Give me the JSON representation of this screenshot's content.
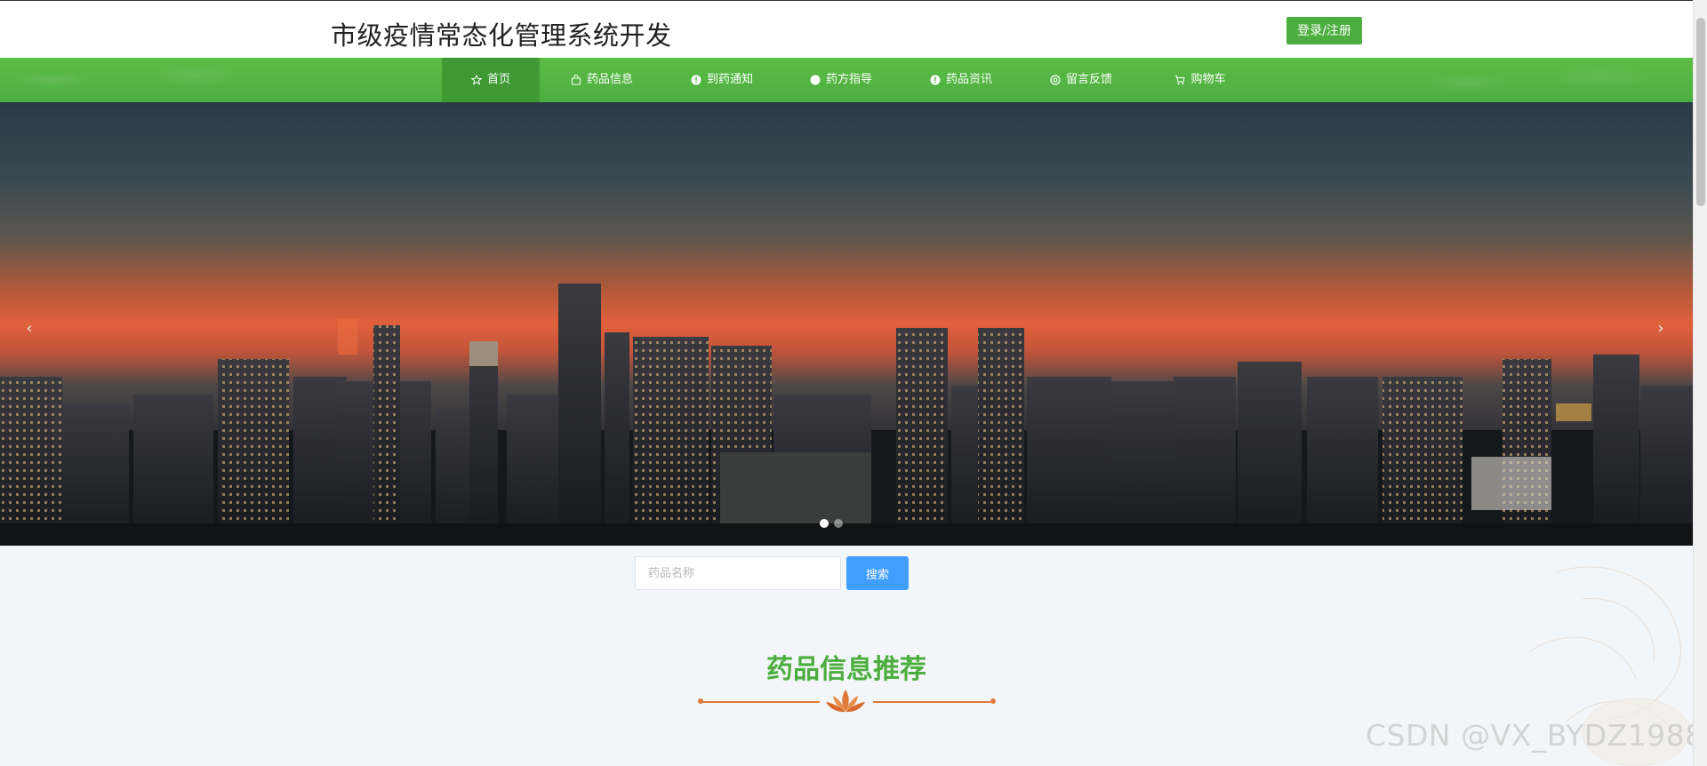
{
  "header": {
    "title": "市级疫情常态化管理系统开发",
    "login_label": "登录/注册"
  },
  "nav": {
    "items": [
      {
        "label": "首页",
        "icon": "star-icon",
        "active": true
      },
      {
        "label": "药品信息",
        "icon": "bag-icon",
        "active": false
      },
      {
        "label": "到药通知",
        "icon": "info-icon",
        "active": false
      },
      {
        "label": "药方指导",
        "icon": "circle-icon",
        "active": false
      },
      {
        "label": "药品资讯",
        "icon": "info-icon",
        "active": false
      },
      {
        "label": "留言反馈",
        "icon": "gear-icon",
        "active": false
      },
      {
        "label": "购物车",
        "icon": "cart-icon",
        "active": false
      }
    ]
  },
  "banner": {
    "prev": "‹",
    "next": "›",
    "slide_count": 2,
    "active_slide": 0
  },
  "search": {
    "placeholder": "药品名称",
    "button_label": "搜索"
  },
  "section": {
    "title": "药品信息推荐"
  },
  "watermark": "CSDN @VX_BYDZ1988",
  "colors": {
    "brand_green": "#4cae3f",
    "search_blue": "#409eff",
    "accent_orange": "#e07a3a"
  }
}
